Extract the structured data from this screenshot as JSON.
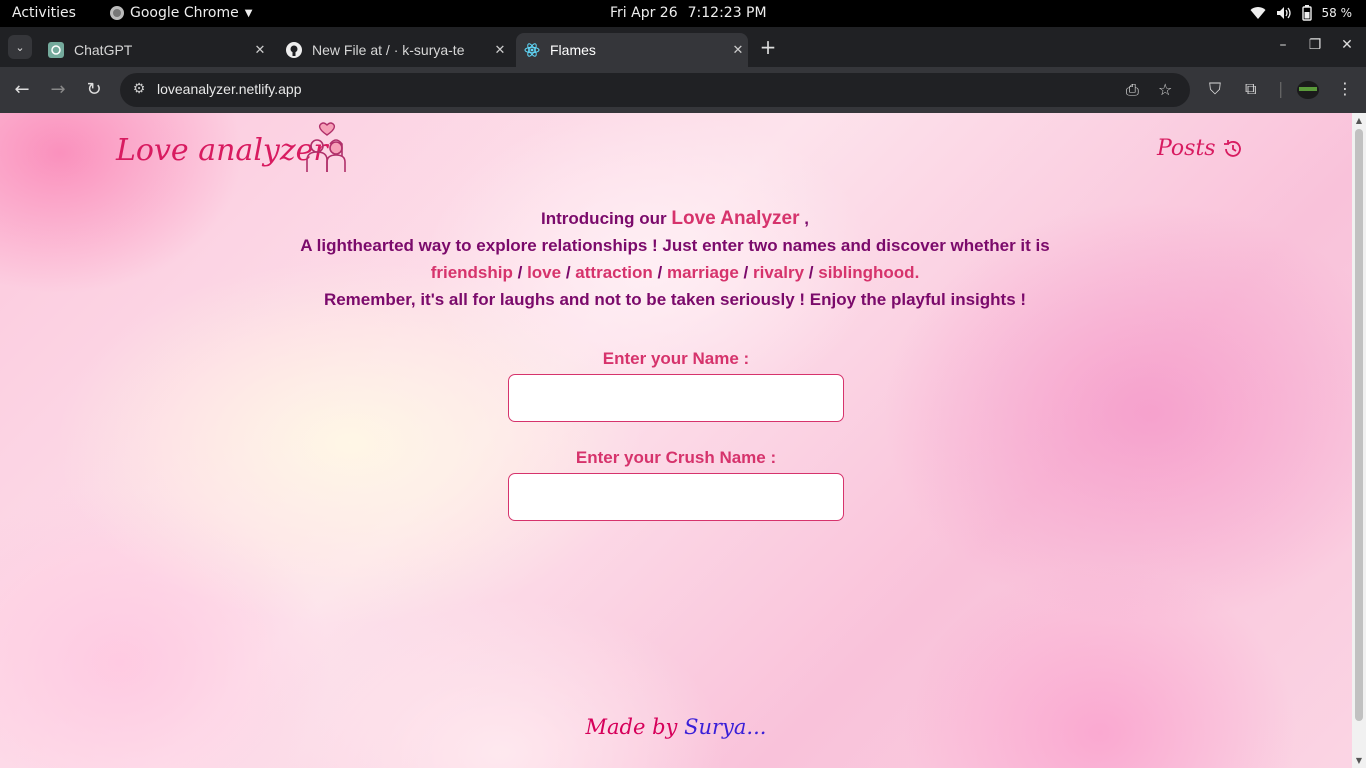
{
  "system": {
    "activities": "Activities",
    "app_name": "Google Chrome",
    "date": "Fri Apr 26",
    "time": "7:12:23 PM",
    "battery": "58 %"
  },
  "tabs": [
    {
      "title": "ChatGPT",
      "icon": "chatgpt-icon"
    },
    {
      "title": "New File at / · k-surya-te",
      "icon": "github-icon"
    },
    {
      "title": "Flames",
      "icon": "react-icon",
      "active": true
    }
  ],
  "toolbar": {
    "url": "loveanalyzer.netlify.app"
  },
  "page": {
    "logo": "Love analyzer",
    "posts": "Posts",
    "intro": {
      "l1_prefix": "Introducing our",
      "l1_name": "Love Analyzer",
      "l1_suffix": ",",
      "l2": "A lighthearted way to explore relationships ! Just enter two names and discover whether it is",
      "relations": [
        "friendship",
        "love",
        "attraction",
        "marriage",
        "rivalry",
        "siblinghood."
      ],
      "separator": "/",
      "l4": "Remember, it's all for laughs and not to be taken seriously ! Enjoy the playful insights !"
    },
    "form": {
      "name_label": "Enter your Name :",
      "name_value": "",
      "crush_label": "Enter your Crush Name :",
      "crush_value": ""
    },
    "footer": {
      "prefix": "Made by",
      "author": "Surya..."
    }
  },
  "colors": {
    "accent": "#d6336c",
    "intro_text": "#7b0a6b",
    "logo": "#d81b60"
  }
}
